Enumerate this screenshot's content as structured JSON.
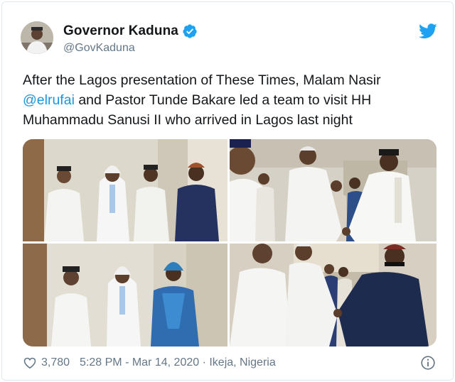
{
  "tweet": {
    "display_name": "Governor Kaduna",
    "handle": "@GovKaduna",
    "verified": true,
    "text_part1": "After the Lagos presentation of These Times, Malam Nasir ",
    "mention": "@elrufai",
    "text_part2": " and Pastor Tunde Bakare led a team to visit HH Muhammadu Sanusi II who arrived in Lagos last night",
    "photo_count": 4
  },
  "footer": {
    "likes": "3,780",
    "timestamp": "5:28 PM - Mar 14, 2020",
    "separator": " · ",
    "location": "Ikeja, Nigeria"
  },
  "icons": {
    "brand": "twitter-bird-icon",
    "verified": "verified-badge-icon",
    "like": "heart-icon",
    "info": "info-icon"
  },
  "colors": {
    "twitter_blue": "#1da1f2",
    "link_blue": "#1b95e0",
    "text_primary": "#14171a",
    "text_secondary": "#657786",
    "border": "#e1e8ed"
  }
}
